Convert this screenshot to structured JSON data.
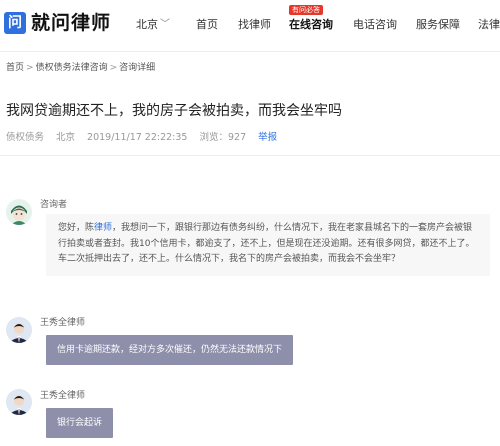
{
  "header": {
    "logo_char": "问",
    "brand": "就问律师",
    "city": "北京",
    "city_chevron": "﹀",
    "nav": [
      {
        "label": "首页"
      },
      {
        "label": "找律师"
      },
      {
        "label": "在线咨询"
      },
      {
        "label": "电话咨询"
      },
      {
        "label": "服务保障"
      },
      {
        "label": "法律"
      }
    ],
    "nav_badge": "有问必答"
  },
  "breadcrumb": [
    "首页",
    "债权债务法律咨询",
    "咨询详细"
  ],
  "breadcrumb_sep": ">",
  "question": {
    "title": "我网贷逾期还不上，我的房子会被拍卖，而我会坐牢吗",
    "category": "债权债务",
    "city": "北京",
    "datetime": "2019/11/17 22:22:35",
    "views": "浏览：927",
    "report": "举报"
  },
  "asker": {
    "name": "咨询者",
    "body_prefix": "您好，陈",
    "body_highlight": "律师",
    "body_rest": "，我想问一下，跟银行那边有债务纠纷，什么情况下，我在老家县城名下的一套房产会被银行拍卖或者查封。我10个信用卡，都逾支了，还不上，但是现在还没逾期。还有很多网贷，都还不上了。车二次抵押出去了，还不上。什么情况下，我名下的房产会被拍卖，而我会不会坐牢？"
  },
  "answers": [
    {
      "lawyer": "王秀全律师",
      "text": "信用卡逾期还款，经对方多次催还，仍然无法还款情况下"
    },
    {
      "lawyer": "王秀全律师",
      "text": "银行会起诉"
    }
  ],
  "colors": {
    "brand_blue": "#2f6fde",
    "badge_red": "#e6372b",
    "answer_bubble": "#8d8fab"
  }
}
